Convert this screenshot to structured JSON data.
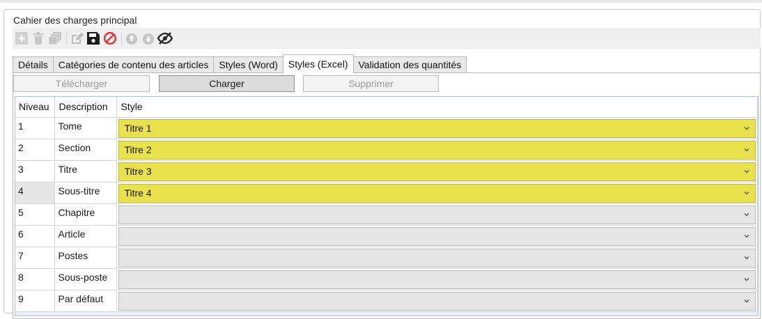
{
  "group": {
    "title": "Cahier des charges principal"
  },
  "toolbar": {
    "icons": [
      "add-icon",
      "delete-icon",
      "copy-icon",
      "edit-icon",
      "save-icon",
      "cancel-icon",
      "upload-cloud-icon",
      "download-cloud-icon",
      "hide-icon"
    ]
  },
  "tabs": [
    {
      "label": "Détails"
    },
    {
      "label": "Catégories de contenu des articles"
    },
    {
      "label": "Styles (Word)"
    },
    {
      "label": "Styles (Excel)",
      "active": true
    },
    {
      "label": "Validation des quantités"
    }
  ],
  "actions": {
    "download_label": "Télécharger",
    "load_label": "Charger",
    "delete_label": "Supprimer"
  },
  "grid": {
    "columns": [
      "Niveau",
      "Description",
      "Style"
    ],
    "rows": [
      {
        "niveau": "1",
        "description": "Tome",
        "style": "Titre 1"
      },
      {
        "niveau": "2",
        "description": "Section",
        "style": "Titre 2"
      },
      {
        "niveau": "3",
        "description": "Titre",
        "style": "Titre 3"
      },
      {
        "niveau": "4",
        "description": "Sous-titre",
        "style": "Titre 4"
      },
      {
        "niveau": "5",
        "description": "Chapitre",
        "style": ""
      },
      {
        "niveau": "6",
        "description": "Article",
        "style": ""
      },
      {
        "niveau": "7",
        "description": "Postes",
        "style": ""
      },
      {
        "niveau": "8",
        "description": "Sous-poste",
        "style": ""
      },
      {
        "niveau": "9",
        "description": "Par défaut",
        "style": ""
      }
    ]
  },
  "colors": {
    "style_assigned": "#eae24d",
    "style_empty": "#e6e6e6",
    "cancel_icon": "#e23b3b",
    "toolbar_bg": "#efefef"
  }
}
